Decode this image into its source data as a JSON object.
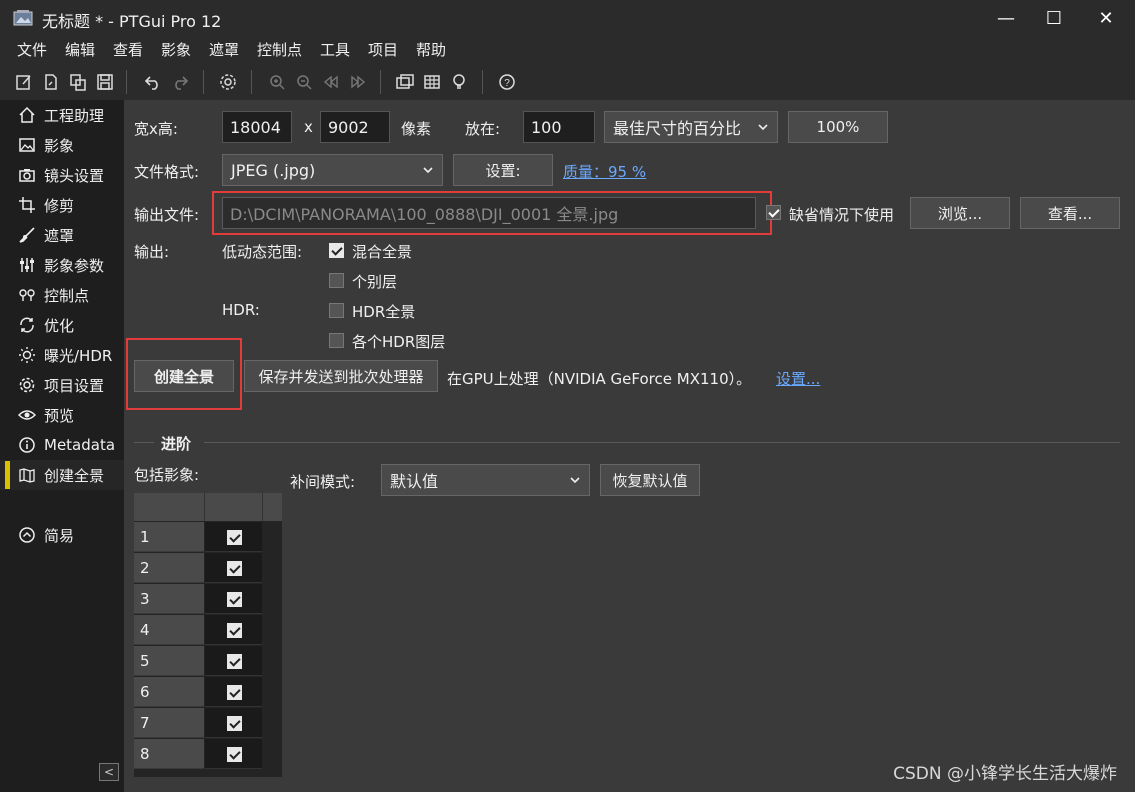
{
  "window": {
    "title": "无标题 * - PTGui Pro 12",
    "minimize": "—",
    "maximize": "☐",
    "close": "✕"
  },
  "menu": [
    "文件",
    "编辑",
    "查看",
    "影象",
    "遮罩",
    "控制点",
    "工具",
    "项目",
    "帮助"
  ],
  "toolbar": {
    "icons": [
      "new-project-icon",
      "open-project-icon",
      "copy-project-icon",
      "save-icon",
      "undo-icon",
      "redo-icon",
      "settings-gear-icon",
      "zoom-in-icon",
      "zoom-out-icon",
      "previous-icon",
      "next-icon",
      "panorama-editor-icon",
      "table-grid-icon",
      "bulb-tip-icon",
      "help-icon"
    ]
  },
  "sidebar": {
    "items": [
      {
        "label": "工程助理",
        "icon": "home-icon"
      },
      {
        "label": "影象",
        "icon": "image-icon"
      },
      {
        "label": "镜头设置",
        "icon": "camera-icon"
      },
      {
        "label": "修剪",
        "icon": "crop-icon"
      },
      {
        "label": "遮罩",
        "icon": "brush-icon"
      },
      {
        "label": "影象参数",
        "icon": "sliders-icon"
      },
      {
        "label": "控制点",
        "icon": "control-points-icon"
      },
      {
        "label": "优化",
        "icon": "optimize-icon"
      },
      {
        "label": "曝光/HDR",
        "icon": "sun-icon"
      },
      {
        "label": "项目设置",
        "icon": "gear-icon"
      },
      {
        "label": "预览",
        "icon": "eye-icon"
      },
      {
        "label": "Metadata",
        "icon": "info-icon"
      },
      {
        "label": "创建全景",
        "icon": "map-icon"
      }
    ],
    "simple": {
      "label": "简易",
      "icon": "chevron-up-circle-icon"
    },
    "collapse": "<"
  },
  "size": {
    "label": "宽x高:",
    "width": "18004",
    "x": "x",
    "height": "9002",
    "unit": "像素",
    "scale_label": "放在:",
    "scale_value": "100",
    "scale_mode": "最佳尺寸的百分比",
    "percent_button": "100%"
  },
  "format": {
    "label": "文件格式:",
    "value": "JPEG (.jpg)",
    "settings_button": "设置:",
    "quality_link": "质量：95 %"
  },
  "output_file": {
    "label": "输出文件:",
    "value": "D:\\DCIM\\PANORAMA\\100_0888\\DJI_0001 全景.jpg",
    "default_label": "缺省情况下使用",
    "default_checked": true,
    "browse_button": "浏览...",
    "view_button": "查看..."
  },
  "output": {
    "label": "输出:",
    "ldr_label": "低动态范围:",
    "blended": {
      "label": "混合全景",
      "checked": true
    },
    "layers": {
      "label": "个别层",
      "checked": false
    },
    "hdr_label": "HDR:",
    "hdr_pano": {
      "label": "HDR全景",
      "checked": false
    },
    "hdr_layers": {
      "label": "各个HDR图层",
      "checked": false
    }
  },
  "actions": {
    "create_button": "创建全景",
    "batch_button": "保存并发送到批次处理器",
    "gpu_text": "在GPU上处理（NVIDIA GeForce MX110）。",
    "gpu_settings_link": "设置..."
  },
  "advanced": {
    "title": "进阶",
    "include_label": "包括影象:",
    "interp_label": "补间模式:",
    "interp_value": "默认值",
    "reset_button": "恢复默认值",
    "images": [
      {
        "num": "1",
        "checked": true
      },
      {
        "num": "2",
        "checked": true
      },
      {
        "num": "3",
        "checked": true
      },
      {
        "num": "4",
        "checked": true
      },
      {
        "num": "5",
        "checked": true
      },
      {
        "num": "6",
        "checked": true
      },
      {
        "num": "7",
        "checked": true
      },
      {
        "num": "8",
        "checked": true
      }
    ]
  },
  "watermark": "CSDN @小锋学长生活大爆炸",
  "colors": {
    "highlight": "#e23b3b",
    "active_bar": "#d9c200",
    "link": "#6aa9ff"
  }
}
